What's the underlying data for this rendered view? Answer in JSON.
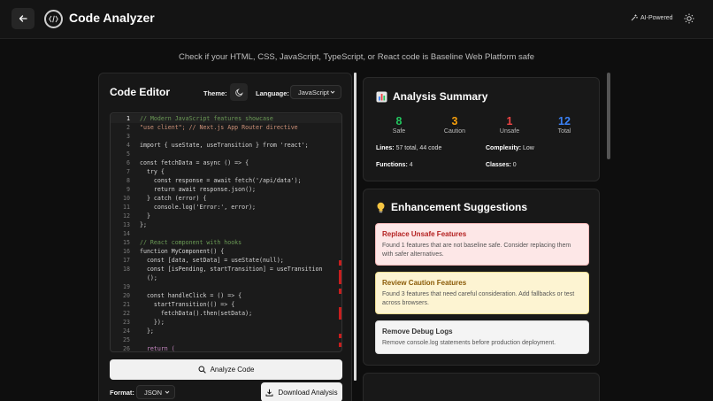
{
  "header": {
    "title": "Code Analyzer",
    "ai_badge": "AI-Powered",
    "icons": [
      "arrow-left-icon",
      "code-logo-icon",
      "sparkle-icon",
      "sun-icon"
    ]
  },
  "subtitle": "Check if your HTML, CSS, JavaScript, TypeScript, or React code is Baseline Web Platform safe",
  "editor": {
    "title": "Code Editor",
    "theme_label": "Theme:",
    "language_label": "Language:",
    "language_value": "JavaScript",
    "lines": [
      {
        "n": "1",
        "text": "// Modern JavaScript features showcase",
        "color": "#6a9955",
        "active": true
      },
      {
        "n": "2",
        "text": "\"use client\"; // Next.js App Router directive",
        "color": "#ce9178"
      },
      {
        "n": "3",
        "text": "",
        "color": "#d4d4d4"
      },
      {
        "n": "4",
        "text": "import { useState, useTransition } from 'react';",
        "color": "#d4d4d4"
      },
      {
        "n": "5",
        "text": "",
        "color": "#d4d4d4"
      },
      {
        "n": "6",
        "text": "const fetchData = async () => {",
        "color": "#d4d4d4"
      },
      {
        "n": "7",
        "text": "  try {",
        "color": "#d4d4d4"
      },
      {
        "n": "8",
        "text": "    const response = await fetch('/api/data');",
        "color": "#d4d4d4"
      },
      {
        "n": "9",
        "text": "    return await response.json();",
        "color": "#d4d4d4"
      },
      {
        "n": "10",
        "text": "  } catch (error) {",
        "color": "#d4d4d4"
      },
      {
        "n": "11",
        "text": "    console.log('Error:', error);",
        "color": "#d4d4d4"
      },
      {
        "n": "12",
        "text": "  }",
        "color": "#d4d4d4"
      },
      {
        "n": "13",
        "text": "};",
        "color": "#d4d4d4"
      },
      {
        "n": "14",
        "text": "",
        "color": "#d4d4d4"
      },
      {
        "n": "15",
        "text": "// React component with hooks",
        "color": "#6a9955"
      },
      {
        "n": "16",
        "text": "function MyComponent() {",
        "color": "#d4d4d4"
      },
      {
        "n": "17",
        "text": "  const [data, setData] = useState(null);",
        "color": "#d4d4d4"
      },
      {
        "n": "18",
        "text": "  const [isPending, startTransition] = useTransition",
        "color": "#d4d4d4"
      },
      {
        "n": "",
        "text": "  ();",
        "color": "#d4d4d4"
      },
      {
        "n": "19",
        "text": "",
        "color": "#d4d4d4"
      },
      {
        "n": "20",
        "text": "  const handleClick = () => {",
        "color": "#d4d4d4"
      },
      {
        "n": "21",
        "text": "    startTransition(() => {",
        "color": "#d4d4d4"
      },
      {
        "n": "22",
        "text": "      fetchData().then(setData);",
        "color": "#d4d4d4"
      },
      {
        "n": "23",
        "text": "    });",
        "color": "#d4d4d4"
      },
      {
        "n": "24",
        "text": "  };",
        "color": "#d4d4d4"
      },
      {
        "n": "25",
        "text": "",
        "color": "#d4d4d4"
      },
      {
        "n": "26",
        "text": "  return (",
        "color": "#c586c0"
      }
    ],
    "analyze_label": "Analyze Code",
    "format_label": "Format:",
    "format_value": "JSON",
    "download_label": "Download Analysis"
  },
  "summary": {
    "title": "Analysis Summary",
    "stats": [
      {
        "value": "8",
        "label": "Safe",
        "color": "#22c55e"
      },
      {
        "value": "3",
        "label": "Caution",
        "color": "#f59e0b"
      },
      {
        "value": "1",
        "label": "Unsafe",
        "color": "#ef4444"
      },
      {
        "value": "12",
        "label": "Total",
        "color": "#3b82f6"
      }
    ],
    "lines_key": "Lines:",
    "lines_val": "57 total, 44 code",
    "complexity_key": "Complexity:",
    "complexity_val": "Low",
    "functions_key": "Functions:",
    "functions_val": "4",
    "classes_key": "Classes:",
    "classes_val": "0"
  },
  "suggestions": {
    "title": "Enhancement Suggestions",
    "items": [
      {
        "title": "Replace Unsafe Features",
        "desc": "Found 1 features that are not baseline safe. Consider replacing them with safer alternatives."
      },
      {
        "title": "Review Caution Features",
        "desc": "Found 3 features that need careful consideration. Add fallbacks or test across browsers."
      },
      {
        "title": "Remove Debug Logs",
        "desc": "Remove console.log statements before production deployment."
      }
    ]
  }
}
